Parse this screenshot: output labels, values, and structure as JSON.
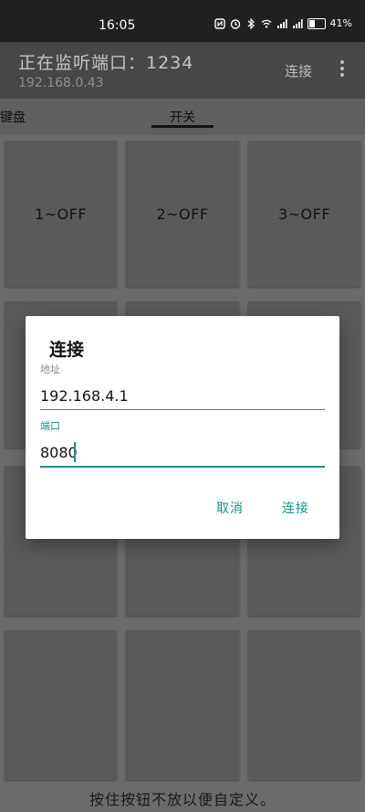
{
  "status_bar": {
    "time": "16:05",
    "battery_level": "41%",
    "icons": [
      "nfc-icon",
      "alarm-icon",
      "bluetooth-icon",
      "wifi-icon",
      "signal-icon",
      "signal-icon",
      "battery-icon"
    ]
  },
  "toolbar": {
    "title": "正在监听端口：1234",
    "subtitle": "192.168.0.43",
    "connect_label": "连接",
    "more_icon": "more-vert-icon"
  },
  "tabs": [
    {
      "label": "键盘"
    },
    {
      "label": "开关"
    }
  ],
  "grid": {
    "buttons": [
      {
        "label": "1~OFF"
      },
      {
        "label": "2~OFF"
      },
      {
        "label": "3~OFF"
      },
      {
        "label": ""
      },
      {
        "label": ""
      },
      {
        "label": ""
      },
      {
        "label": ""
      },
      {
        "label": ""
      },
      {
        "label": ""
      },
      {
        "label": ""
      },
      {
        "label": ""
      },
      {
        "label": ""
      }
    ],
    "footer_hint": "按住按钮不放以便自定义。"
  },
  "dialog": {
    "title": "连接",
    "address_label": "地址",
    "address_value": "192.168.4.1",
    "port_label": "端口",
    "port_value": "8080",
    "cancel_label": "取消",
    "connect_label": "连接",
    "accent_color": "#1a8f88"
  }
}
